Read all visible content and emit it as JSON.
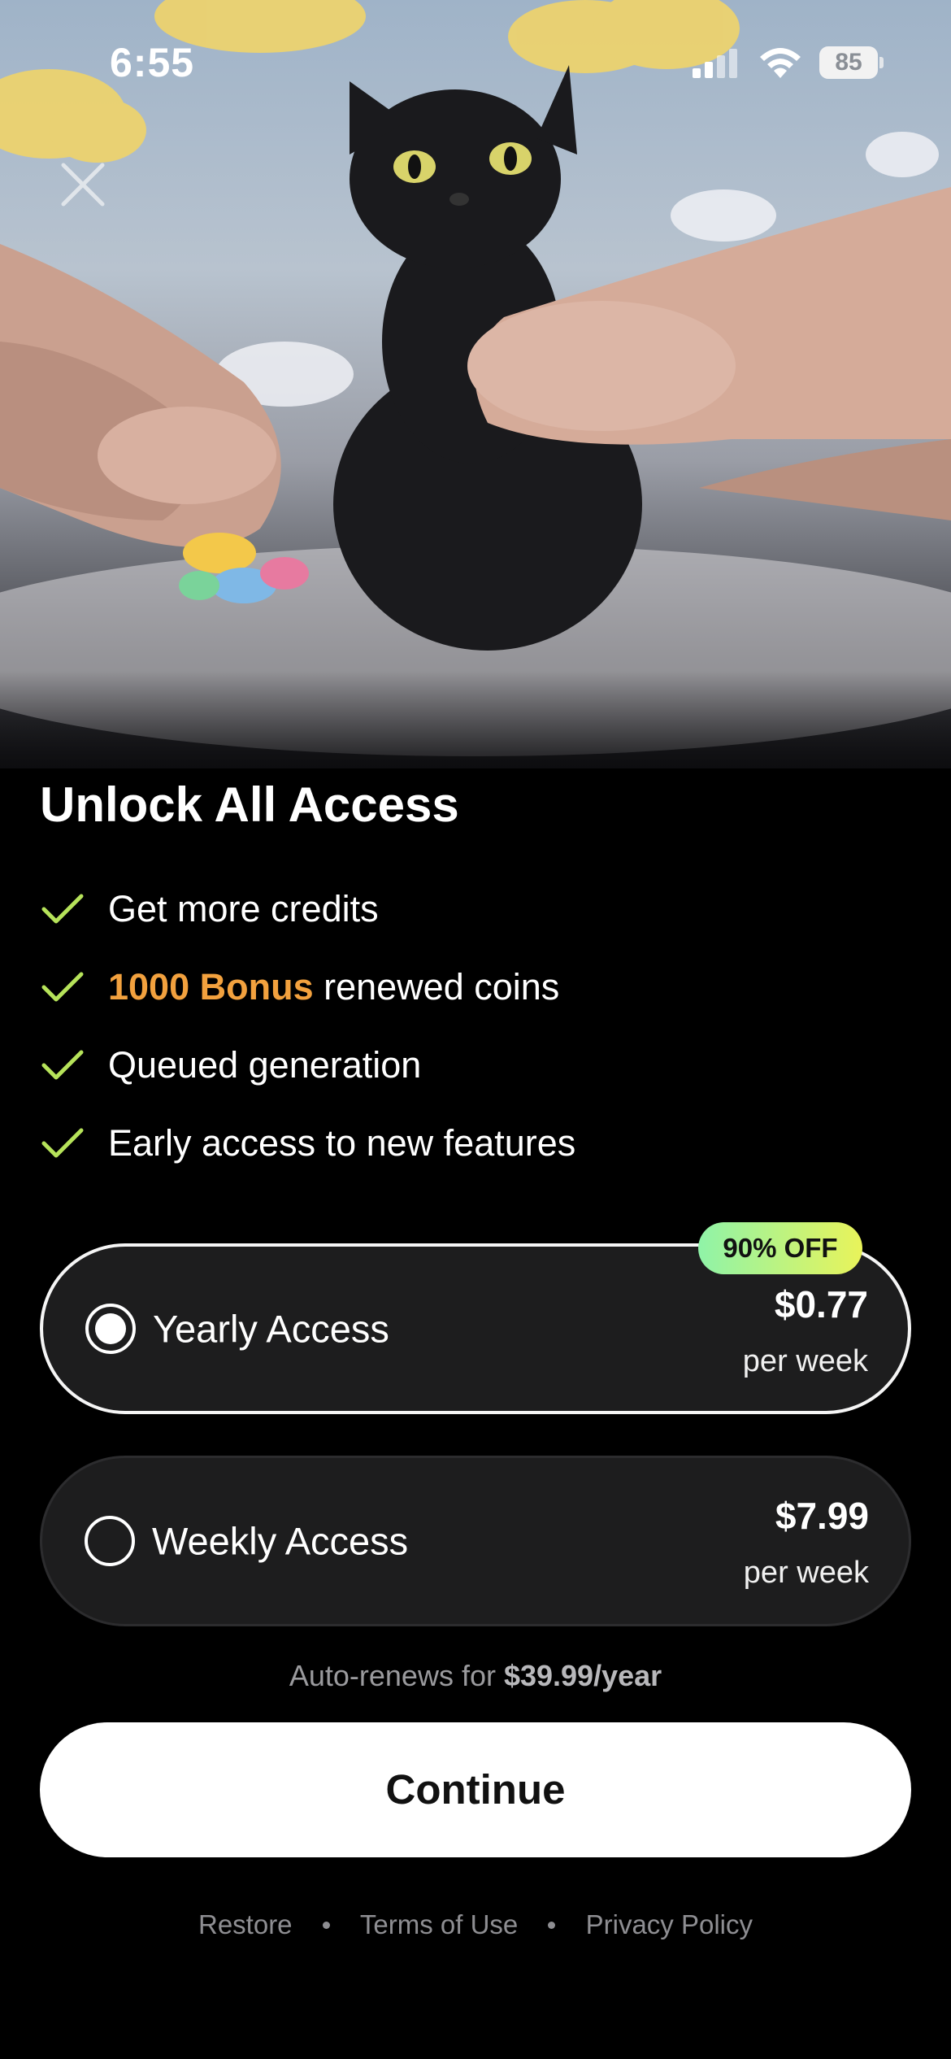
{
  "status_bar": {
    "time": "6:55",
    "battery": "85"
  },
  "header": {
    "title": "Unlock All Access"
  },
  "features": [
    {
      "prefix": "",
      "highlight": "",
      "text": "Get more credits"
    },
    {
      "prefix": "",
      "highlight": "1000 Bonus",
      "text": " renewed coins"
    },
    {
      "prefix": "",
      "highlight": "",
      "text": "Queued generation"
    },
    {
      "prefix": "",
      "highlight": "",
      "text": "Early access to new features"
    }
  ],
  "plans": {
    "yearly": {
      "name": "Yearly Access",
      "price": "$0.77",
      "unit": "per week",
      "badge": "90% OFF",
      "selected": true
    },
    "weekly": {
      "name": "Weekly Access",
      "price": "$7.99",
      "unit": "per week",
      "selected": false
    }
  },
  "auto_renew": {
    "prefix": "Auto-renews for ",
    "amount": "$39.99/year"
  },
  "continue_label": "Continue",
  "footer": {
    "restore": "Restore",
    "terms": "Terms of Use",
    "privacy": "Privacy Policy"
  },
  "icons": {
    "close": "close-icon",
    "check": "check-icon",
    "signal": "signal-icon",
    "wifi": "wifi-icon"
  },
  "colors": {
    "accent_check": "#b6e35a",
    "highlight": "#f2a13e",
    "badge_start": "#8ff3a8",
    "badge_end": "#e9f35a"
  }
}
